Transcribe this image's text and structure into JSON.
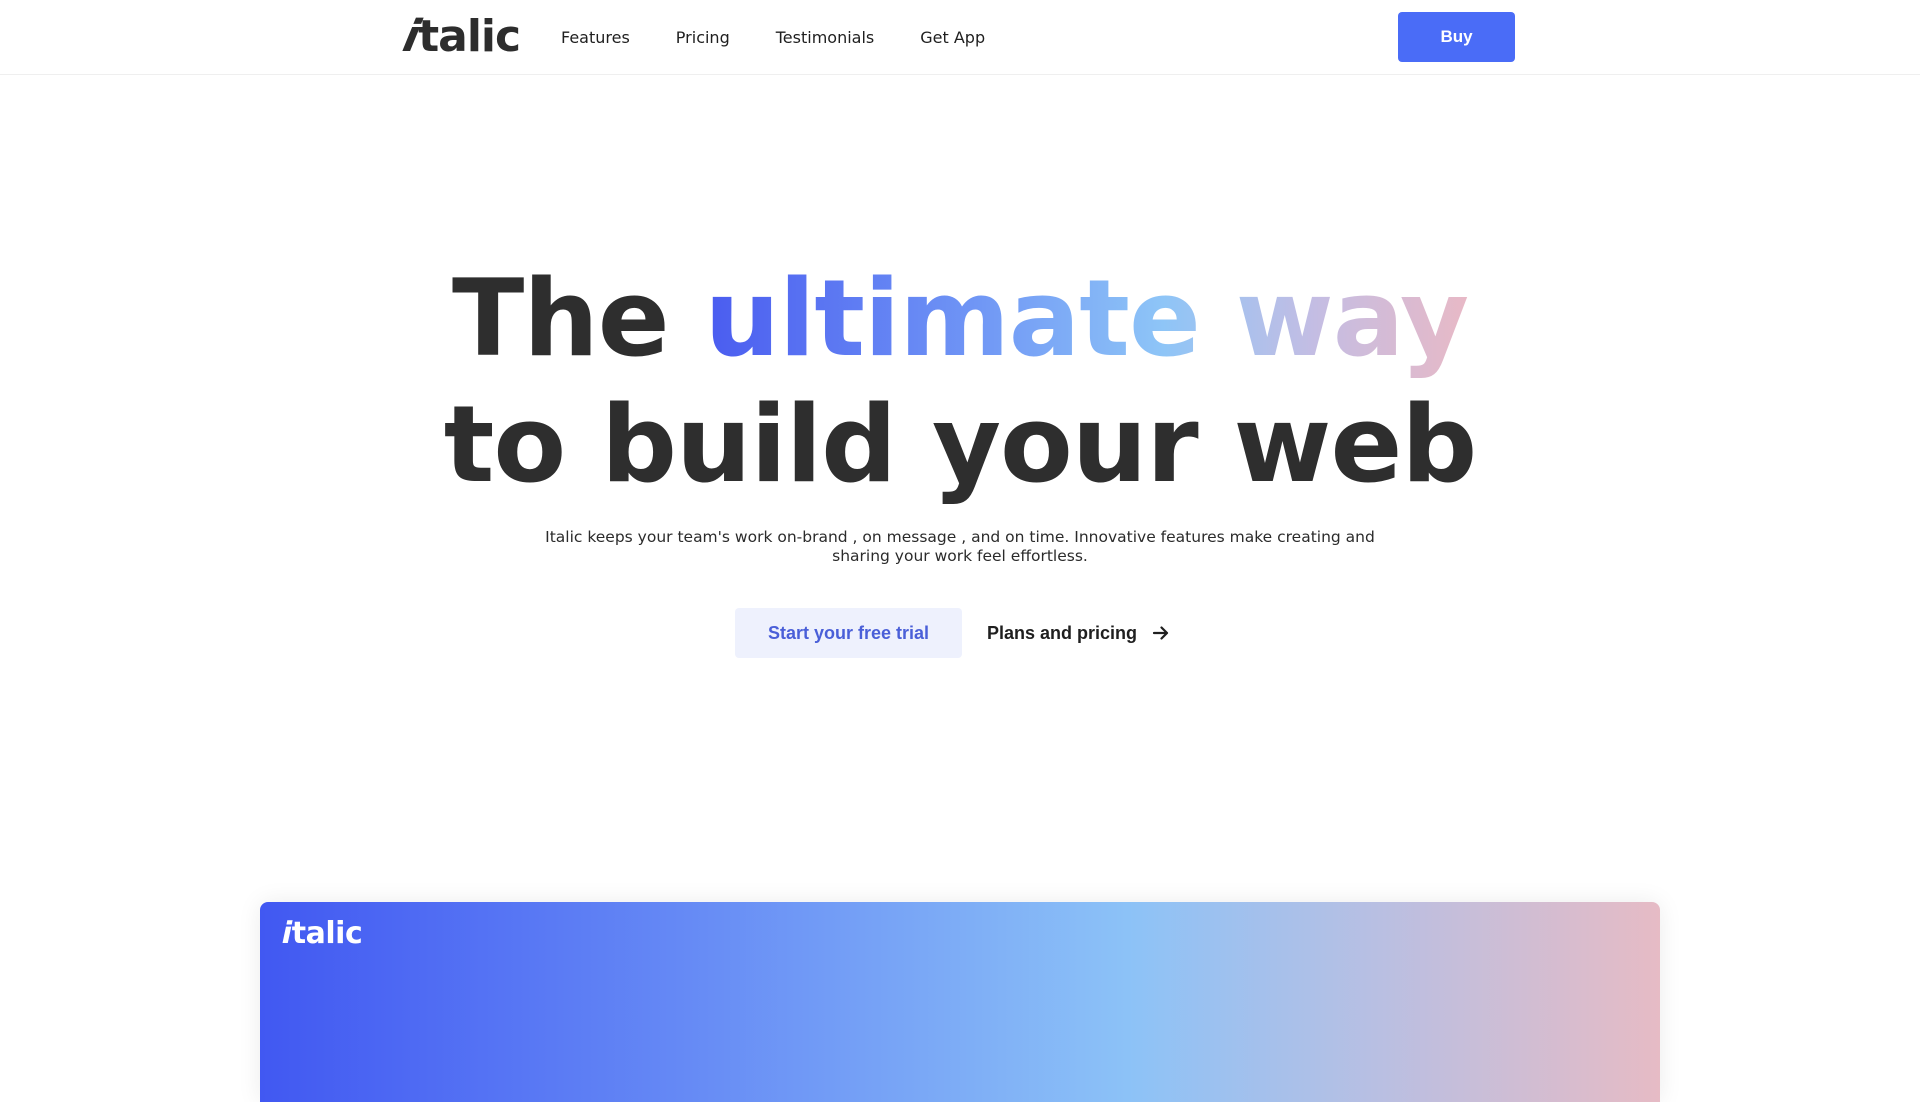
{
  "header": {
    "logo": {
      "first": "i",
      "rest": "talic"
    },
    "nav": [
      "Features",
      "Pricing",
      "Testimonials",
      "Get App"
    ],
    "buy_label": "Buy"
  },
  "hero": {
    "title_line1_plain": "The ",
    "title_line1_gradient": "ultimate way",
    "title_line2": "to build your web",
    "subtitle": "Italic keeps your team's work on-brand , on message , and on time. Innovative features make creating and sharing your work feel effortless.",
    "primary_cta": "Start your free trial",
    "secondary_cta": "Plans and pricing",
    "secondary_cta_icon": "arrow-right-icon"
  },
  "preview": {
    "logo": {
      "first": "i",
      "rest": "talic"
    }
  },
  "colors": {
    "accent": "#4a6cf7",
    "trial_bg": "#eef1fd",
    "trial_text": "#4a5fd8",
    "gradient_start": "#4158f2",
    "gradient_mid": "#8cc2f7",
    "gradient_end": "#e6bbc5"
  }
}
